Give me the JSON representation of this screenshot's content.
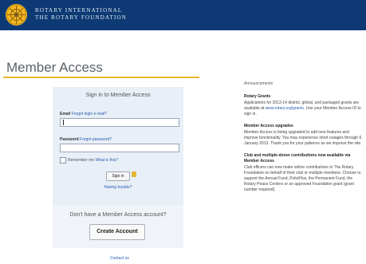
{
  "header": {
    "brand_line1": "ROTARY INTERNATIONAL",
    "brand_line2": "THE ROTARY FOUNDATION"
  },
  "main": {
    "title": "Member Access"
  },
  "signin": {
    "title": "Sign in to Member Access",
    "email_label": "Email",
    "email_forgot": "Forgot login e-mail?",
    "email_value": "",
    "password_label": "Password",
    "password_forgot": "Forgot password?",
    "password_value": "",
    "remember_label": "Remember me",
    "remember_link": "What is this?",
    "signin_button": "Sign in",
    "trouble_link": "Having trouble?"
  },
  "create": {
    "prompt": "Don't have a Member Access account?",
    "button": "Create Account"
  },
  "footer": {
    "contact": "Contact us"
  },
  "sidebar": {
    "heading": "Announcements",
    "items": [
      {
        "title": "Rotary Grants",
        "body": "Applications for 2013-14 district, global, and packaged grants are available at",
        "link": "www.rotary.org/grants",
        "tail": ". Use your Member Access ID to sign in."
      },
      {
        "title": "Member Access upgrades",
        "body": "Member Access is being upgraded to add new features and improve functionality. You may experience short outages through 6 January 2013. Thank you for your patience as we improve the site."
      },
      {
        "title": "Club and multiple-donor contributions now available via Member Access",
        "body": "Club officers can now make online contributions to The Rotary Foundation on behalf of their club or multiple members. Choose to support the Annual Fund, PolioPlus, the Permanent Fund, the Rotary Peace Centers or an approved Foundation grant (grant number required)."
      }
    ]
  }
}
